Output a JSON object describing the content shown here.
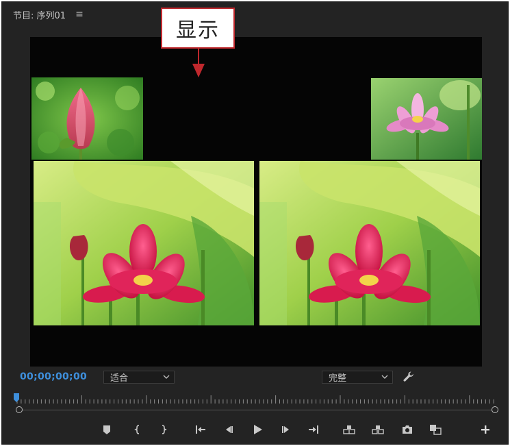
{
  "panel": {
    "title": "节目: 序列01",
    "menu_icon": "hamburger-menu-icon"
  },
  "callout": {
    "text": "显示",
    "border_color": "#c0282d"
  },
  "controls": {
    "timecode": "00;00;00;00",
    "zoom": {
      "selected": "适合"
    },
    "quality": {
      "selected": "完整"
    },
    "settings_icon": "wrench-icon"
  },
  "colors": {
    "panel_bg": "#232323",
    "viewer_bg": "#050505",
    "timecode": "#3e8fdc",
    "icon": "#c8c8c8"
  },
  "transport_icons": [
    "add-marker-icon",
    "mark-in-icon",
    "mark-out-icon",
    "go-to-in-icon",
    "step-back-icon",
    "play-icon",
    "step-forward-icon",
    "go-to-out-icon",
    "lift-icon",
    "extract-icon",
    "export-frame-icon",
    "comparison-view-icon",
    "button-editor-plus-icon"
  ]
}
